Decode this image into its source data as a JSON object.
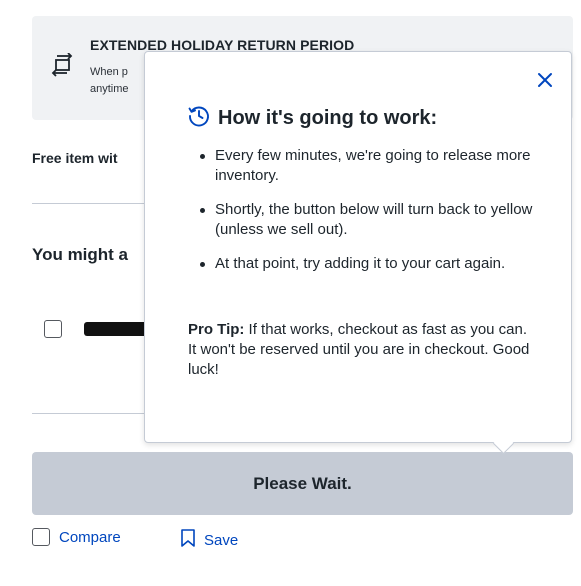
{
  "return_banner": {
    "title": "EXTENDED HOLIDAY RETURN PERIOD",
    "desc_line1": "When p",
    "desc_line2": "anytime"
  },
  "free_item_text": "Free item wit",
  "you_might_text": "You might a",
  "wait_button_label": "Please Wait.",
  "compare_label": "Compare",
  "save_label": "Save",
  "popover": {
    "title": "How it's going to work:",
    "bullets": [
      "Every few minutes, we're going to release more inventory.",
      "Shortly, the button below will turn back to yellow (unless we sell out).",
      "At that point, try adding it to your cart again."
    ],
    "protip_label": "Pro Tip:",
    "protip_text": " If that works, checkout as fast as you can. It won't be reserved until you are in checkout. Good luck!",
    "close_icon": "close-icon"
  },
  "colors": {
    "link": "#0046be",
    "button_disabled": "#c5cbd5",
    "banner_bg": "#f0f2f4",
    "text": "#1d252c"
  }
}
